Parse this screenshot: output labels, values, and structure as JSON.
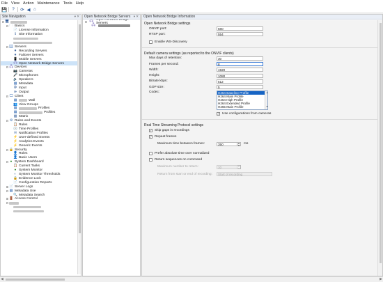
{
  "menu": [
    "File",
    "View",
    "Action",
    "Maintenance",
    "Tools",
    "Help"
  ],
  "toolbar": {
    "icons": [
      "save-icon",
      "help-icon",
      "refresh-icon",
      "back-icon",
      "home-icon"
    ]
  },
  "nav": {
    "title": "Site Navigation",
    "pin": "▾ ✕",
    "tree": [
      {
        "depth": 0,
        "tw": "⊟",
        "icon": "🖥",
        "label": "",
        "blur": 24
      },
      {
        "depth": 1,
        "tw": "⊟",
        "icon": "🗀",
        "label": "Basics"
      },
      {
        "depth": 2,
        "tw": "",
        "icon": "📄",
        "label": "License Information"
      },
      {
        "depth": 2,
        "tw": "",
        "icon": "ℹ",
        "label": "Site Information"
      },
      {
        "depth": 2,
        "tw": "",
        "icon": "",
        "label": "",
        "blur": 36
      },
      {
        "depth": 2,
        "tw": "",
        "icon": "",
        "label": "",
        "blur": 56
      },
      {
        "depth": 1,
        "tw": "⊟",
        "icon": "🗄",
        "label": "Servers"
      },
      {
        "depth": 2,
        "tw": "",
        "icon": "⏺",
        "label": "Recording Servers"
      },
      {
        "depth": 2,
        "tw": "",
        "icon": "⏺",
        "label": "Failover Servers"
      },
      {
        "depth": 2,
        "tw": "",
        "icon": "📱",
        "label": "Mobile Servers"
      },
      {
        "depth": 2,
        "tw": "",
        "icon": "🖧",
        "label": "Open Network Bridge Servers",
        "selected": true
      },
      {
        "depth": 1,
        "tw": "⊟",
        "icon": "🖧",
        "label": "Devices"
      },
      {
        "depth": 2,
        "tw": "",
        "icon": "📷",
        "label": "Cameras"
      },
      {
        "depth": 2,
        "tw": "",
        "icon": "🎤",
        "label": "Microphones"
      },
      {
        "depth": 2,
        "tw": "",
        "icon": "🔈",
        "label": "Speakers"
      },
      {
        "depth": 2,
        "tw": "",
        "icon": "▦",
        "label": "Metadata"
      },
      {
        "depth": 2,
        "tw": "",
        "icon": "⭆",
        "label": "Input"
      },
      {
        "depth": 2,
        "tw": "",
        "icon": "⭄",
        "label": "Output"
      },
      {
        "depth": 1,
        "tw": "⊟",
        "icon": "🖵",
        "label": "Client"
      },
      {
        "depth": 2,
        "tw": "",
        "icon": "▦",
        "label": "Wall",
        "blur": 12
      },
      {
        "depth": 2,
        "tw": "",
        "icon": "👥",
        "label": "View Groups"
      },
      {
        "depth": 2,
        "tw": "",
        "icon": "▦",
        "label": "Profiles",
        "blur": 26
      },
      {
        "depth": 2,
        "tw": "",
        "icon": "▦",
        "label": "Profiles",
        "blur": 34
      },
      {
        "depth": 2,
        "tw": "",
        "icon": "▩",
        "label": "Matrix"
      },
      {
        "depth": 1,
        "tw": "⊟",
        "icon": "⚙",
        "label": "Rules and Events"
      },
      {
        "depth": 2,
        "tw": "",
        "icon": "📋",
        "label": "Rules"
      },
      {
        "depth": 2,
        "tw": "",
        "icon": "🕓",
        "label": "Time Profiles"
      },
      {
        "depth": 2,
        "tw": "",
        "icon": "✉",
        "label": "Notification Profiles"
      },
      {
        "depth": 2,
        "tw": "",
        "icon": "⚡",
        "label": "User-defined Events"
      },
      {
        "depth": 2,
        "tw": "",
        "icon": "⚡",
        "label": "Analytics Events"
      },
      {
        "depth": 2,
        "tw": "",
        "icon": "⚡",
        "label": "Generic Events"
      },
      {
        "depth": 1,
        "tw": "⊟",
        "icon": "🔒",
        "label": "Security"
      },
      {
        "depth": 2,
        "tw": "",
        "icon": "👤",
        "label": "Roles"
      },
      {
        "depth": 2,
        "tw": "",
        "icon": "👤",
        "label": "Basic Users"
      },
      {
        "depth": 1,
        "tw": "⊟",
        "icon": "●",
        "label": "System Dashboard"
      },
      {
        "depth": 2,
        "tw": "",
        "icon": "📋",
        "label": "Current Tasks"
      },
      {
        "depth": 2,
        "tw": "",
        "icon": "●",
        "label": "System Monitor"
      },
      {
        "depth": 2,
        "tw": "",
        "icon": "◐",
        "label": "System Monitor Thresholds"
      },
      {
        "depth": 2,
        "tw": "",
        "icon": "🔒",
        "label": "Evidence Lock"
      },
      {
        "depth": 2,
        "tw": "",
        "icon": "📄",
        "label": "Configuration Reports"
      },
      {
        "depth": 1,
        "tw": "⊞",
        "icon": "📄",
        "label": "Server Logs"
      },
      {
        "depth": 1,
        "tw": "⊟",
        "icon": "▦",
        "label": "Metadata Use"
      },
      {
        "depth": 2,
        "tw": "",
        "icon": "🔍",
        "label": "Metadata Search"
      },
      {
        "depth": 1,
        "tw": "⊞",
        "icon": "🚪",
        "label": "Access Control"
      },
      {
        "depth": 1,
        "tw": "⊟",
        "icon": "",
        "label": "",
        "blur": 14
      },
      {
        "depth": 2,
        "tw": "",
        "icon": "",
        "label": "",
        "blur": 40
      },
      {
        "depth": 2,
        "tw": "",
        "icon": "",
        "label": "",
        "blur": 44
      }
    ]
  },
  "list": {
    "title": "Open Network Bridge Servers",
    "pin": "▾ ✕",
    "root": "Open Network Bridge Servers",
    "child_blur": 46
  },
  "props": {
    "title": "Open Network Bridge Information",
    "section1": "Open Network Bridge settings",
    "onvif_port": {
      "label": "ONVIF port:",
      "value": "580"
    },
    "rtsp_port": {
      "label": "RTSP port:",
      "value": "554"
    },
    "ws_discovery": {
      "label": "Enable WS-Discovery",
      "checked": false
    },
    "section2": "Default camera settings (as reported to the ONVIF clients)",
    "fields": [
      {
        "label": "Max days of retention:",
        "value": "30",
        "focus": false
      },
      {
        "label": "Frames per second:",
        "value": "8",
        "focus": true
      },
      {
        "label": "Width:",
        "value": "1920",
        "focus": false
      },
      {
        "label": "Height:",
        "value": "1080",
        "focus": false
      },
      {
        "label": "Bitrate kbps:",
        "value": "512",
        "focus": false
      },
      {
        "label": "GOP size:",
        "value": "5",
        "focus": false
      }
    ],
    "codec": {
      "label": "Codec:",
      "options": [
        "H264 Baseline Profile",
        "H264 Main Profile",
        "H264 High Profile",
        "H264 Extended Profile",
        "H265 Main Profile"
      ],
      "selected": 0
    },
    "use_camera_config": {
      "label": "Use configurations from cameras",
      "checked": true
    },
    "section3": "Real Time Streaming Protocol settings",
    "skip_gaps": {
      "label": "Skip gaps in recordings",
      "checked": true
    },
    "repeat_frames": {
      "label": "Repeat frames",
      "checked": true
    },
    "max_time": {
      "label": "Maximum time between frames:",
      "value": "350",
      "unit": "ms"
    },
    "prefer_abs": {
      "label": "Prefer absolute time over normalized",
      "checked": false
    },
    "return_seq": {
      "label": "Return sequences on command",
      "checked": false
    },
    "max_return": {
      "label": "Maximum number to return:",
      "value": "10"
    },
    "return_from": {
      "label": "Return from start or end of recording:",
      "value": "Start of recording"
    }
  }
}
